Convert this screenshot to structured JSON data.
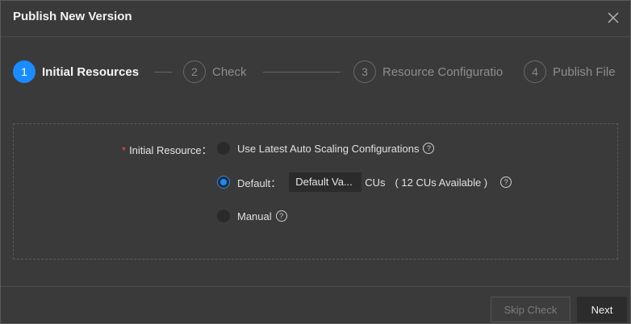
{
  "dialog": {
    "title": "Publish New Version"
  },
  "steps": [
    {
      "number": "1",
      "label": "Initial Resources",
      "active": true
    },
    {
      "number": "2",
      "label": "Check",
      "active": false
    },
    {
      "number": "3",
      "label": "Resource Configuratio",
      "active": false
    },
    {
      "number": "4",
      "label": "Publish File",
      "active": false
    }
  ],
  "form": {
    "required_mark": "*",
    "label": "Initial Resource：",
    "options": [
      {
        "label": "Use Latest Auto Scaling Configurations",
        "selected": false
      },
      {
        "label": "Default：",
        "selected": true,
        "select_value": "Default Va...",
        "unit": "CUs",
        "available": "( 12 CUs Available )"
      },
      {
        "label": "Manual",
        "selected": false
      }
    ],
    "help_glyph": "?"
  },
  "footer": {
    "skip_label": "Skip Check",
    "next_label": "Next"
  },
  "colors": {
    "accent": "#1a8cff",
    "background": "#3a3a3a",
    "required": "#ff4d4f"
  },
  "icons": {
    "close": "close-icon",
    "help": "question-circle-icon"
  }
}
